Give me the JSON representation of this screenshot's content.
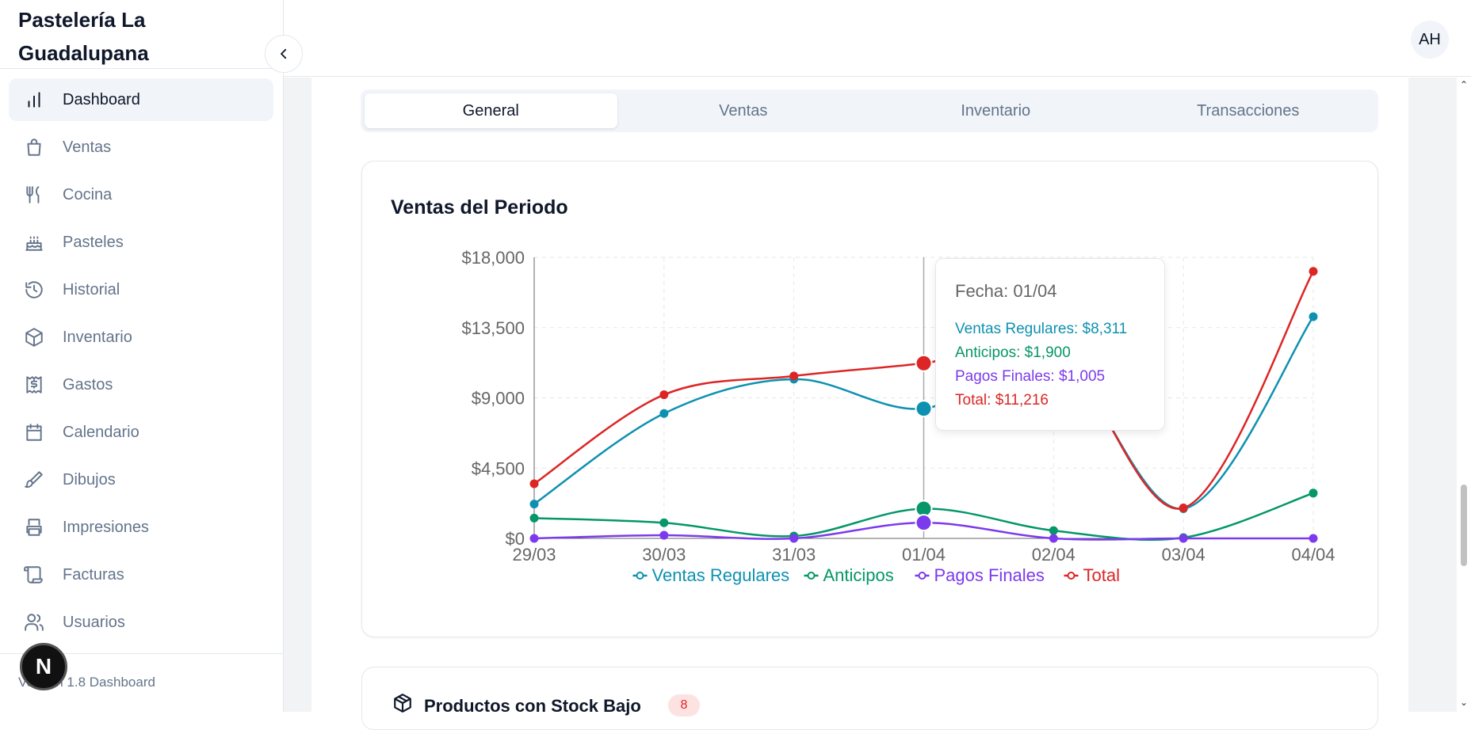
{
  "app": {
    "brand": "Pastelería La Guadalupana",
    "version": "Version 1.8 Dashboard"
  },
  "sidebar": {
    "items": [
      {
        "label": "Dashboard",
        "icon": "bar-chart-icon",
        "active": true
      },
      {
        "label": "Ventas",
        "icon": "shopping-bag-icon"
      },
      {
        "label": "Cocina",
        "icon": "utensils-icon"
      },
      {
        "label": "Pasteles",
        "icon": "cake-icon"
      },
      {
        "label": "Historial",
        "icon": "history-icon"
      },
      {
        "label": "Inventario",
        "icon": "package-icon"
      },
      {
        "label": "Gastos",
        "icon": "receipt-icon"
      },
      {
        "label": "Calendario",
        "icon": "calendar-icon"
      },
      {
        "label": "Dibujos",
        "icon": "brush-icon"
      },
      {
        "label": "Impresiones",
        "icon": "printer-icon"
      },
      {
        "label": "Facturas",
        "icon": "scroll-icon"
      },
      {
        "label": "Usuarios",
        "icon": "users-icon"
      }
    ]
  },
  "header": {
    "avatar": "AH"
  },
  "tabs": [
    {
      "label": "General",
      "active": true
    },
    {
      "label": "Ventas"
    },
    {
      "label": "Inventario"
    },
    {
      "label": "Transacciones"
    }
  ],
  "sales_card": {
    "title": "Ventas del Periodo"
  },
  "tooltip": {
    "date": "Fecha: 01/04",
    "lines": [
      {
        "text": "Ventas Regulares: $8,311",
        "color": "#0e91b0"
      },
      {
        "text": "Anticipos: $1,900",
        "color": "#059669"
      },
      {
        "text": "Pagos Finales: $1,005",
        "color": "#7c3aed"
      },
      {
        "text": "Total: $11,216",
        "color": "#dc2626"
      }
    ]
  },
  "low_stock": {
    "title": "Productos con Stock Bajo",
    "count": "8"
  },
  "chart_data": {
    "type": "line",
    "x": [
      "29/03",
      "30/03",
      "31/03",
      "01/04",
      "02/04",
      "03/04",
      "04/04"
    ],
    "yticks": [
      "$0",
      "$4,500",
      "$9,000",
      "$13,500",
      "$18,000"
    ],
    "ylim": [
      0,
      18000
    ],
    "grid": true,
    "legend_position": "bottom",
    "highlight_index": 3,
    "series": [
      {
        "name": "Ventas Regulares",
        "color": "#0e91b0",
        "values": [
          2200,
          8000,
          10200,
          8311,
          11800,
          1900,
          14200
        ]
      },
      {
        "name": "Anticipos",
        "color": "#059669",
        "values": [
          1300,
          1000,
          150,
          1900,
          500,
          50,
          2900
        ]
      },
      {
        "name": "Pagos Finales",
        "color": "#7c3aed",
        "values": [
          0,
          200,
          0,
          1005,
          0,
          0,
          0
        ]
      },
      {
        "name": "Total",
        "color": "#dc2626",
        "values": [
          3500,
          9200,
          10400,
          11216,
          12300,
          1950,
          17100
        ]
      }
    ]
  }
}
